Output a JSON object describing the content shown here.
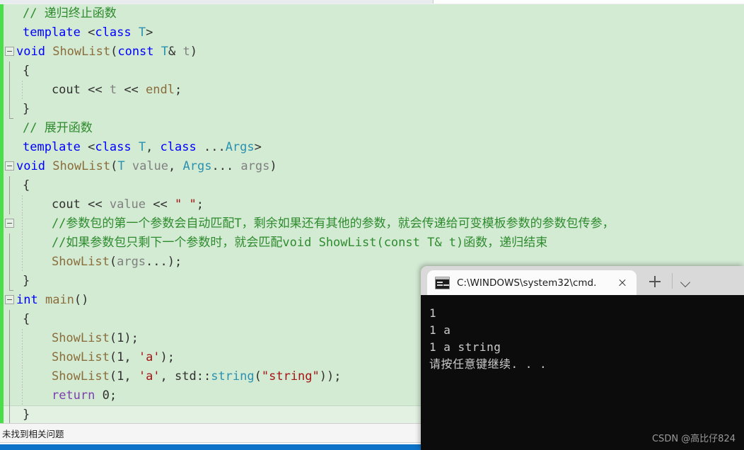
{
  "editor": {
    "language": "cpp",
    "background_color": "#d3ead3",
    "change_bar_color": "#4ade4a",
    "lines": [
      {
        "indent": 1,
        "fold": "none",
        "guide": false,
        "current": false,
        "tokens": [
          {
            "t": "// 递归终止函数",
            "c": "cm"
          }
        ]
      },
      {
        "indent": 1,
        "fold": "none",
        "guide": false,
        "current": false,
        "tokens": [
          {
            "t": "template",
            "c": "k"
          },
          {
            "t": " <",
            "c": "pl"
          },
          {
            "t": "class",
            "c": "k"
          },
          {
            "t": " ",
            "c": "pl"
          },
          {
            "t": "T",
            "c": "tp"
          },
          {
            "t": ">",
            "c": "pl"
          }
        ]
      },
      {
        "indent": 0,
        "fold": "box",
        "guide": false,
        "current": false,
        "tokens": [
          {
            "t": "void",
            "c": "k"
          },
          {
            "t": " ",
            "c": "pl"
          },
          {
            "t": "ShowList",
            "c": "fn"
          },
          {
            "t": "(",
            "c": "pl"
          },
          {
            "t": "const",
            "c": "k"
          },
          {
            "t": " ",
            "c": "pl"
          },
          {
            "t": "T",
            "c": "tp"
          },
          {
            "t": "& ",
            "c": "pl"
          },
          {
            "t": "t",
            "c": "var"
          },
          {
            "t": ")",
            "c": "pl"
          }
        ]
      },
      {
        "indent": 1,
        "fold": "line",
        "guide": false,
        "current": false,
        "tokens": [
          {
            "t": "{",
            "c": "pl"
          }
        ]
      },
      {
        "indent": 1,
        "fold": "line",
        "guide": true,
        "current": false,
        "tokens": [
          {
            "t": "    cout << ",
            "c": "pl"
          },
          {
            "t": "t",
            "c": "var"
          },
          {
            "t": " << ",
            "c": "pl"
          },
          {
            "t": "endl",
            "c": "fn"
          },
          {
            "t": ";",
            "c": "pl"
          }
        ]
      },
      {
        "indent": 1,
        "fold": "tip",
        "guide": false,
        "current": false,
        "tokens": [
          {
            "t": "}",
            "c": "pl"
          }
        ]
      },
      {
        "indent": 1,
        "fold": "none",
        "guide": false,
        "current": false,
        "tokens": [
          {
            "t": "// 展开函数",
            "c": "cm"
          }
        ]
      },
      {
        "indent": 1,
        "fold": "none",
        "guide": false,
        "current": false,
        "tokens": [
          {
            "t": "template",
            "c": "k"
          },
          {
            "t": " <",
            "c": "pl"
          },
          {
            "t": "class",
            "c": "k"
          },
          {
            "t": " ",
            "c": "pl"
          },
          {
            "t": "T",
            "c": "tp"
          },
          {
            "t": ", ",
            "c": "pl"
          },
          {
            "t": "class",
            "c": "k"
          },
          {
            "t": " ...",
            "c": "pl"
          },
          {
            "t": "Args",
            "c": "tp"
          },
          {
            "t": ">",
            "c": "pl"
          }
        ]
      },
      {
        "indent": 0,
        "fold": "box",
        "guide": false,
        "current": false,
        "tokens": [
          {
            "t": "void",
            "c": "k"
          },
          {
            "t": " ",
            "c": "pl"
          },
          {
            "t": "ShowList",
            "c": "fn"
          },
          {
            "t": "(",
            "c": "pl"
          },
          {
            "t": "T",
            "c": "tp"
          },
          {
            "t": " ",
            "c": "pl"
          },
          {
            "t": "value",
            "c": "var"
          },
          {
            "t": ", ",
            "c": "pl"
          },
          {
            "t": "Args",
            "c": "tp"
          },
          {
            "t": "... ",
            "c": "pl"
          },
          {
            "t": "args",
            "c": "var"
          },
          {
            "t": ")",
            "c": "pl"
          }
        ]
      },
      {
        "indent": 1,
        "fold": "line",
        "guide": false,
        "current": false,
        "tokens": [
          {
            "t": "{",
            "c": "pl"
          }
        ]
      },
      {
        "indent": 1,
        "fold": "line",
        "guide": true,
        "current": false,
        "tokens": [
          {
            "t": "    cout << ",
            "c": "pl"
          },
          {
            "t": "value",
            "c": "var"
          },
          {
            "t": " << ",
            "c": "pl"
          },
          {
            "t": "\" \"",
            "c": "st"
          },
          {
            "t": ";",
            "c": "pl"
          }
        ]
      },
      {
        "indent": 1,
        "fold": "box2",
        "guide": true,
        "current": false,
        "tokens": [
          {
            "t": "    //参数包的第一个参数会自动匹配T，剩余如果还有其他的参数，就会传递给可变模板参数的参数包传参，",
            "c": "cm"
          }
        ]
      },
      {
        "indent": 1,
        "fold": "line",
        "guide": true,
        "current": false,
        "tokens": [
          {
            "t": "    //如果参数包只剩下一个参数时，就会匹配void ShowList(const T& t)函数，递归结束",
            "c": "cm"
          }
        ]
      },
      {
        "indent": 1,
        "fold": "line",
        "guide": true,
        "current": false,
        "tokens": [
          {
            "t": "    ",
            "c": "pl"
          },
          {
            "t": "ShowList",
            "c": "fn"
          },
          {
            "t": "(",
            "c": "pl"
          },
          {
            "t": "args",
            "c": "var"
          },
          {
            "t": "...);",
            "c": "pl"
          }
        ]
      },
      {
        "indent": 1,
        "fold": "tip",
        "guide": false,
        "current": false,
        "tokens": [
          {
            "t": "}",
            "c": "pl"
          }
        ]
      },
      {
        "indent": 0,
        "fold": "box",
        "guide": false,
        "current": false,
        "tokens": [
          {
            "t": "int",
            "c": "k"
          },
          {
            "t": " ",
            "c": "pl"
          },
          {
            "t": "main",
            "c": "fn"
          },
          {
            "t": "()",
            "c": "pl"
          }
        ]
      },
      {
        "indent": 1,
        "fold": "line",
        "guide": false,
        "current": false,
        "tokens": [
          {
            "t": "{",
            "c": "pl"
          }
        ]
      },
      {
        "indent": 1,
        "fold": "line",
        "guide": true,
        "current": false,
        "tokens": [
          {
            "t": "    ",
            "c": "pl"
          },
          {
            "t": "ShowList",
            "c": "fn"
          },
          {
            "t": "(",
            "c": "pl"
          },
          {
            "t": "1",
            "c": "nm"
          },
          {
            "t": ");",
            "c": "pl"
          }
        ]
      },
      {
        "indent": 1,
        "fold": "line",
        "guide": true,
        "current": false,
        "tokens": [
          {
            "t": "    ",
            "c": "pl"
          },
          {
            "t": "ShowList",
            "c": "fn"
          },
          {
            "t": "(",
            "c": "pl"
          },
          {
            "t": "1",
            "c": "nm"
          },
          {
            "t": ", ",
            "c": "pl"
          },
          {
            "t": "'a'",
            "c": "st"
          },
          {
            "t": ");",
            "c": "pl"
          }
        ]
      },
      {
        "indent": 1,
        "fold": "line",
        "guide": true,
        "current": false,
        "tokens": [
          {
            "t": "    ",
            "c": "pl"
          },
          {
            "t": "ShowList",
            "c": "fn"
          },
          {
            "t": "(",
            "c": "pl"
          },
          {
            "t": "1",
            "c": "nm"
          },
          {
            "t": ", ",
            "c": "pl"
          },
          {
            "t": "'a'",
            "c": "st"
          },
          {
            "t": ", std::",
            "c": "pl"
          },
          {
            "t": "string",
            "c": "tp"
          },
          {
            "t": "(",
            "c": "pl"
          },
          {
            "t": "\"string\"",
            "c": "st"
          },
          {
            "t": "));",
            "c": "pl"
          }
        ]
      },
      {
        "indent": 1,
        "fold": "line",
        "guide": true,
        "current": false,
        "tokens": [
          {
            "t": "    ",
            "c": "pl"
          },
          {
            "t": "return",
            "c": "kr"
          },
          {
            "t": " ",
            "c": "pl"
          },
          {
            "t": "0",
            "c": "nm"
          },
          {
            "t": ";",
            "c": "pl"
          }
        ]
      },
      {
        "indent": 1,
        "fold": "tip",
        "guide": false,
        "current": true,
        "tokens": [
          {
            "t": "}",
            "c": "pl"
          }
        ]
      }
    ]
  },
  "status_bar": {
    "message": "未找到相关问题"
  },
  "terminal": {
    "tab": {
      "icon": "cmd-icon",
      "title": "C:\\WINDOWS\\system32\\cmd.",
      "close_label": "×"
    },
    "new_tab_label": "+",
    "dropdown_label": "⌄",
    "background_color": "#0c0c0c",
    "text_color": "#cccccc",
    "output_lines": [
      "1",
      "1 a",
      "1 a string",
      "请按任意键继续. . ."
    ],
    "watermark": "CSDN @高比仔824"
  }
}
